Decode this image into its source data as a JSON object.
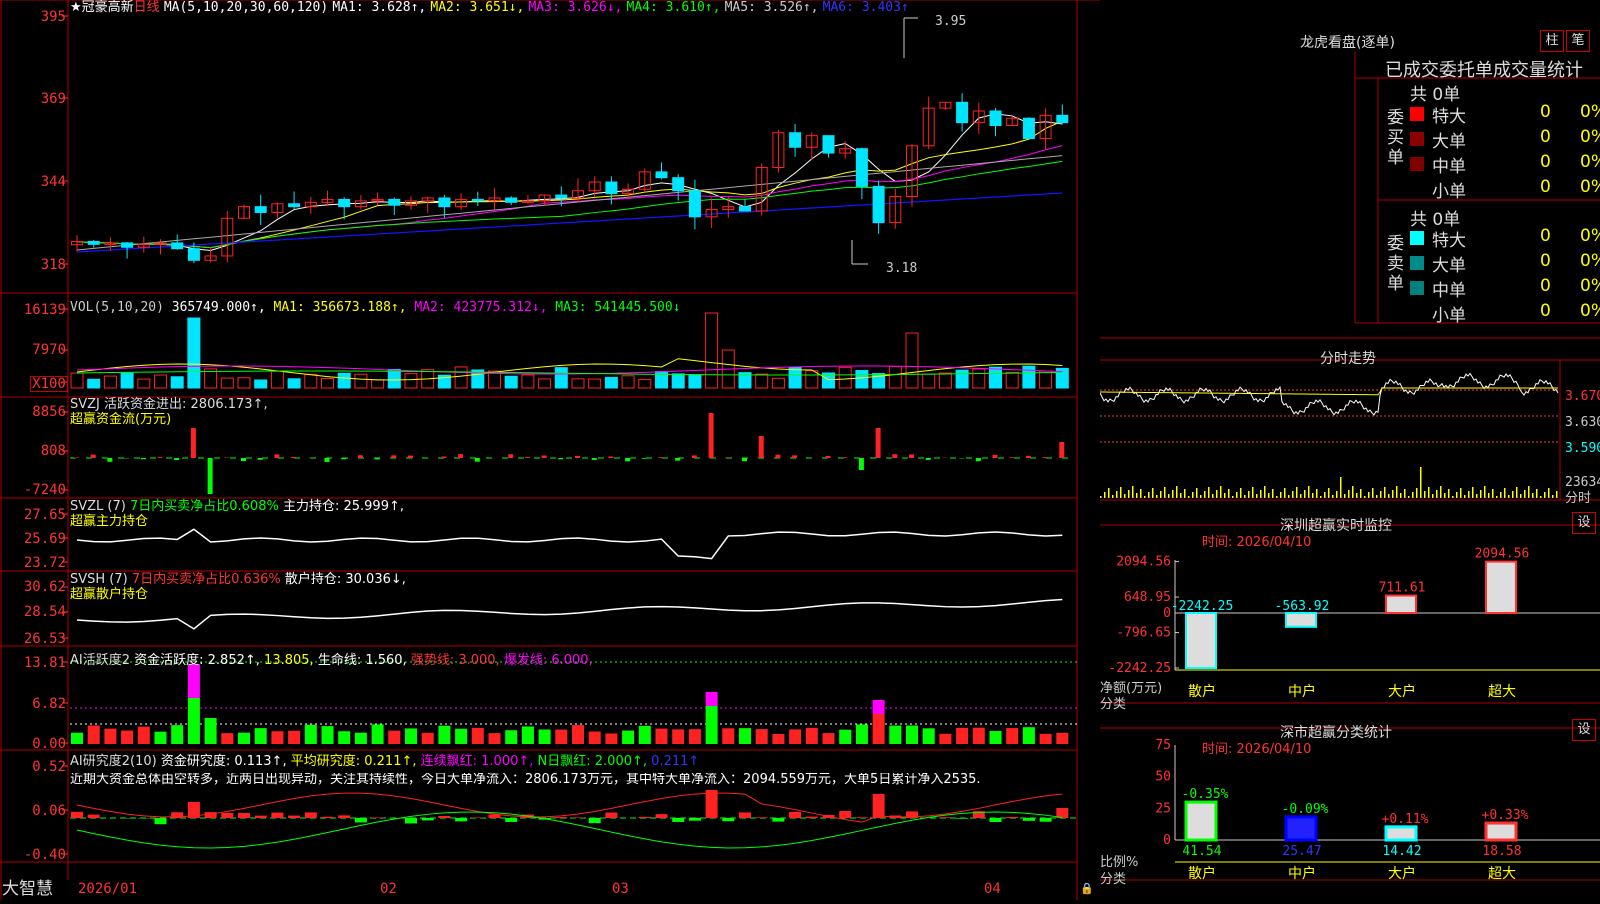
{
  "colors": {
    "up": "#ff2222",
    "down": "#00e5ff",
    "grid": "#b00000",
    "ma1": "#ffffff",
    "ma2": "#ffff00",
    "ma3": "#ff00ff",
    "ma4": "#00ff00",
    "ma5": "#aaaaaa",
    "ma6": "#1414ff"
  },
  "kline": {
    "header": {
      "star": "★",
      "name": "冠豪高新",
      "period": "日线",
      "ma_params": "MA(5,10,20,30,60,120)",
      "ma1": "MA1: 3.628↑,",
      "ma2": "MA2: 3.651↓,",
      "ma3": "MA3: 3.626↓,",
      "ma4": "MA4: 3.610↑,",
      "ma5": "MA5: 3.526↑,",
      "ma6": "MA6: 3.403↑"
    },
    "y_labels": [
      "395",
      "369",
      "344",
      "318"
    ],
    "high_label": "3.95",
    "low_label": "3.18"
  },
  "vol": {
    "header": "VOL(5,10,20)",
    "v": "365749.000↑,",
    "ma1": "MA1: 356673.188↑,",
    "ma2": "MA2: 423775.312↓,",
    "ma3": "MA3: 541445.500↓",
    "y_labels": [
      "16139",
      "7970",
      "X100"
    ]
  },
  "svzj": {
    "header": "SVZJ  活跃资金进出: 2806.173↑,",
    "sub": "超赢资金流(万元)",
    "y_labels": [
      "8856",
      "808",
      "-7240"
    ]
  },
  "svzl": {
    "h1": "SVZL (7)",
    "h2": "7日内买卖净占比0.608%",
    "h3": "主力持仓: 25.999↑,",
    "sub": "超赢主力持仓",
    "y_labels": [
      "27.65",
      "25.69",
      "23.72"
    ]
  },
  "svsh": {
    "h1": "SVSH (7)",
    "h2": "7日内买卖净占比0.636%",
    "h3": "散户持仓: 30.036↓,",
    "sub": "超赢散户持仓",
    "y_labels": [
      "30.62",
      "28.54",
      "26.53"
    ]
  },
  "ai1": {
    "h1": "AI活跃度2",
    "h2": "资金活跃度: 2.852↑,",
    "h3": "13.805,",
    "h4": "生命线: 1.560,",
    "h5": "强势线: 3.000,",
    "h6": "爆发线: 6.000,",
    "y_labels": [
      "13.81",
      "6.82",
      "0.00"
    ]
  },
  "ai2": {
    "h1": "AI研究度2(10)",
    "h2": "资金研究度: 0.113↑,",
    "h3": "平均研究度: 0.211↑,",
    "h4": "连续飘红: 1.000↑,",
    "h5": "N日飘红: 2.000↑,",
    "h6": "0.211↑",
    "comment": "近期大资金总体由空转多，近两日出现异动，关注其持续性，今日大单净流入：2806.173万元，其中特大单净流入：2094.559万元，大单5日累计净入2535.",
    "y_labels": [
      "0.52",
      "0.06",
      "-0.40"
    ]
  },
  "footer": {
    "brand": "大智慧",
    "dates": [
      "2026/01",
      "02",
      "03",
      "04"
    ]
  },
  "right": {
    "lhkp": {
      "title": "龙虎看盘(逐单)",
      "btn1": "柱",
      "btn2": "笔",
      "subtitle": "已成交委托单成交量统计",
      "buy": {
        "label": "委买单",
        "total": "共 0单",
        "rows": [
          {
            "name": "特大",
            "v1": "0",
            "v2": "0%"
          },
          {
            "name": "大单",
            "v1": "0",
            "v2": "0%"
          },
          {
            "name": "中单",
            "v1": "0",
            "v2": "0%"
          },
          {
            "name": "小单",
            "v1": "0",
            "v2": "0%"
          }
        ]
      },
      "sell": {
        "label": "委卖单",
        "total": "共 0单",
        "rows": [
          {
            "name": "特大",
            "v1": "0",
            "v2": "0%"
          },
          {
            "name": "大单",
            "v1": "0",
            "v2": "0%"
          },
          {
            "name": "中单",
            "v1": "0",
            "v2": "0%"
          },
          {
            "name": "小单",
            "v1": "0",
            "v2": "0%"
          }
        ]
      },
      "buy_colors": [
        "#ff0000",
        "#8b0000",
        "#800000"
      ],
      "sell_colors": [
        "#00ffff",
        "#008b8b",
        "#008080"
      ]
    },
    "fenshi": {
      "title": "分时走势",
      "prices": [
        "3.670",
        "3.630",
        "3.590"
      ],
      "vol_label": "23634",
      "tag": "分时"
    },
    "sz_monitor": {
      "title": "深圳超赢实时监控",
      "btn": "设",
      "time": "时间: 2026/04/10",
      "y_labels": [
        "2094.56",
        "648.95",
        "0",
        "-796.65",
        "-2242.25"
      ],
      "side1": "净额(万元)",
      "side2": "分类",
      "categories": [
        "散户",
        "中户",
        "大户",
        "超大"
      ],
      "values": [
        -2242.25,
        -563.92,
        711.61,
        2094.56
      ],
      "value_labels": [
        "-2242.25",
        "-563.92",
        "711.61",
        "2094.56"
      ]
    },
    "sz_class": {
      "title": "深市超赢分类统计",
      "btn": "设",
      "time": "时间: 2026/04/10",
      "y_labels": [
        "75",
        "50",
        "25",
        "0"
      ],
      "side1": "比例%",
      "side2": "分类",
      "categories": [
        "散户",
        "中户",
        "大户",
        "超大"
      ],
      "values": [
        41.54,
        25.47,
        14.42,
        18.58
      ],
      "value_labels": [
        "41.54",
        "25.47",
        "14.42",
        "18.58"
      ],
      "changes": [
        "-0.35%",
        "-0.09%",
        "+0.11%",
        "+0.33%"
      ]
    }
  }
}
